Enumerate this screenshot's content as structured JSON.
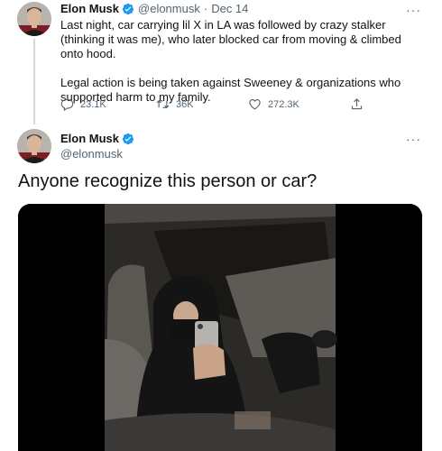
{
  "tweet1": {
    "author": {
      "name": "Elon Musk",
      "handle": "@elonmusk"
    },
    "separator": "·",
    "date": "Dec 14",
    "more_label": "···",
    "paragraphs": [
      "Last night, car carrying lil X in LA was followed by crazy stalker (thinking it was me), who later blocked car from moving & climbed onto hood.",
      "Legal action is being taken against Sweeney & organizations who supported harm to my family."
    ],
    "actions": {
      "replies": "23.1K",
      "retweets": "36K",
      "likes": "272.3K"
    }
  },
  "tweet2": {
    "author": {
      "name": "Elon Musk",
      "handle": "@elonmusk"
    },
    "more_label": "···",
    "text": "Anyone recognize this person or car?"
  },
  "colors": {
    "verified": "#1d9bf0",
    "muted": "#536471",
    "text": "#0f1419",
    "thread_line": "#cfd9de"
  },
  "icons": [
    "verified-badge-icon",
    "more-icon",
    "reply-icon",
    "retweet-icon",
    "like-icon",
    "share-icon"
  ]
}
